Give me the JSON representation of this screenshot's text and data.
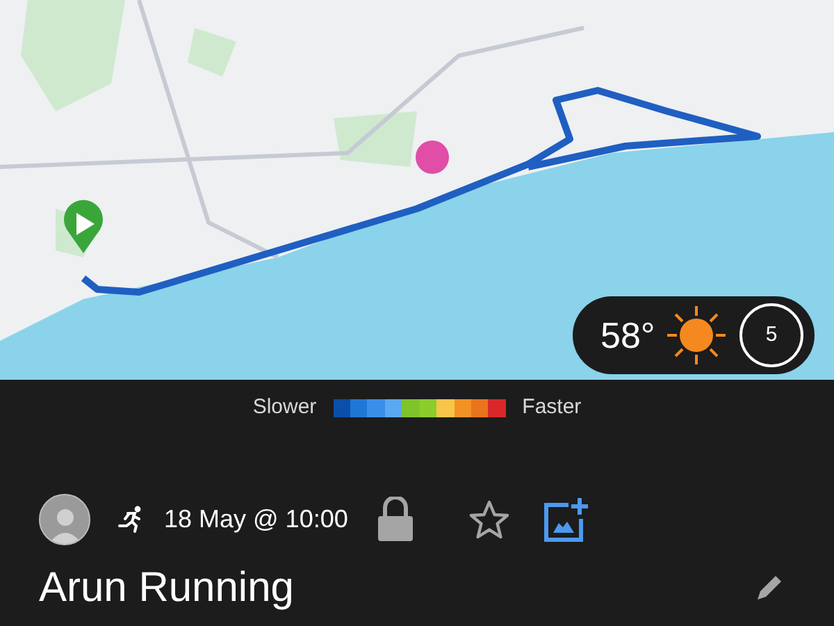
{
  "weather": {
    "temperature": "58°",
    "wind": "5"
  },
  "legend": {
    "slower": "Slower",
    "faster": "Faster",
    "segments": [
      {
        "color": "#0b4fa8"
      },
      {
        "color": "#1f77d6"
      },
      {
        "color": "#3a8ee8"
      },
      {
        "color": "#5aa8f0"
      },
      {
        "color": "#7ec42a"
      },
      {
        "color": "#8ccd2c"
      },
      {
        "color": "#f6c54a"
      },
      {
        "color": "#f39224"
      },
      {
        "color": "#e8741c"
      },
      {
        "color": "#d8282a"
      }
    ]
  },
  "activity": {
    "date": "18 May @ 10:00",
    "private": true,
    "starred": false
  },
  "title": "Arun Running"
}
